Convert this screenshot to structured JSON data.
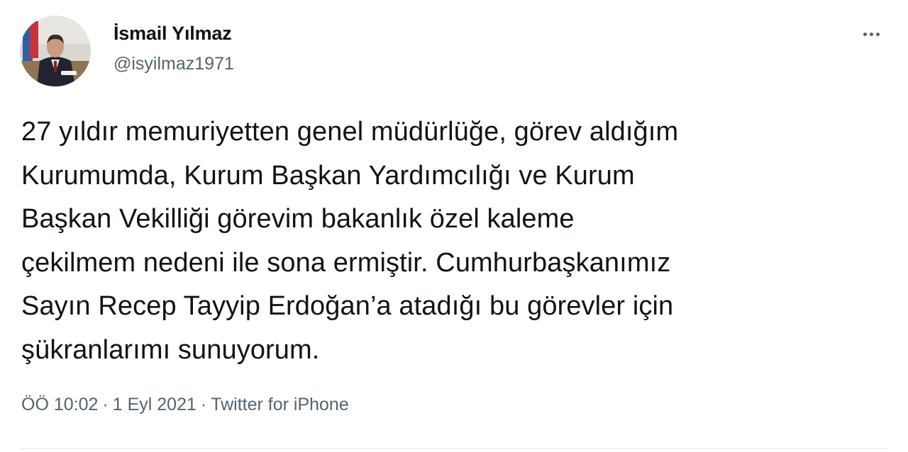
{
  "author": {
    "display_name": "İsmail Yılmaz",
    "handle": "@isyilmaz1971"
  },
  "tweet": {
    "text": "27 yıldır memuriyetten genel müdürlüğe, görev aldığım\nKurumumda, Kurum Başkan Yardımcılığı ve Kurum\nBaşkan Vekilliği görevim bakanlık özel kaleme\nçekilmem nedeni ile sona ermiştir. Cumhurbaşkanımız\nSayın Recep Tayyip Erdoğan’a atadığı bu görevler için\nşükranlarımı sunuyorum."
  },
  "meta": {
    "time": "ÖÖ 10:02",
    "date": "1 Eyl 2021",
    "source": "Twitter for iPhone",
    "separator": "·"
  },
  "icons": {
    "more": "more-horizontal-icon"
  },
  "colors": {
    "text_primary": "#0f1419",
    "text_secondary": "#536471",
    "divider": "#eff3f4"
  }
}
